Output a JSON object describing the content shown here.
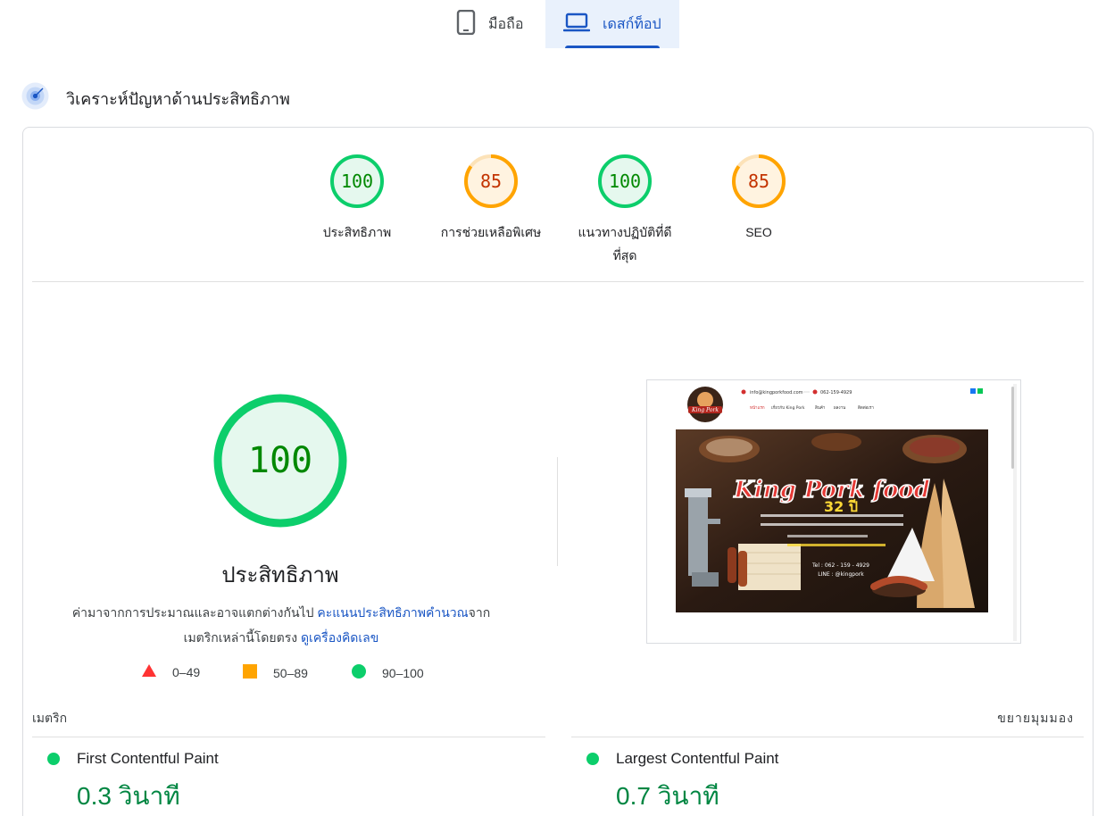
{
  "tabs": {
    "mobile": {
      "label": "มือถือ",
      "icon": "smartphone-icon"
    },
    "desktop": {
      "label": "เดสก์ท็อป",
      "icon": "laptop-icon",
      "selected": true
    }
  },
  "section": {
    "title": "วิเคราะห์ปัญหาด้านประสิทธิภาพ",
    "icon": "radar-icon"
  },
  "scores": [
    {
      "value": "100",
      "label": "ประสิทธิภาพ",
      "status": "pass"
    },
    {
      "value": "85",
      "label": "การช่วยเหลือพิเศษ",
      "status": "average"
    },
    {
      "value": "100",
      "label": "แนวทางปฏิบัติที่ดีที่สุด",
      "status": "pass"
    },
    {
      "value": "85",
      "label": "SEO",
      "status": "average"
    }
  ],
  "performance": {
    "score": "100",
    "title": "ประสิทธิภาพ",
    "desc_before": "ค่ามาจากการประมาณและอาจแตกต่างกันไป ",
    "desc_link1": "คะแนนประสิทธิภาพคำนวณ",
    "desc_middle": "จากเมตริกเหล่านี้โดยตรง ",
    "desc_link2": "ดูเครื่องคิดเลข"
  },
  "legend": [
    {
      "range": "0–49",
      "shape": "triangle",
      "color": "#ff3333"
    },
    {
      "range": "50–89",
      "shape": "square",
      "color": "#ffa400"
    },
    {
      "range": "90–100",
      "shape": "circle",
      "color": "#0cce6b"
    }
  ],
  "preview": {
    "email": "info@kingporkfood.com",
    "phone": "062-159-4929",
    "nav": [
      "หน้าแรก",
      "เกี่ยวกับ King Pork",
      "สินค้า",
      "ผลงาน",
      "ติดต่อเรา"
    ],
    "brand": "King Pork food",
    "tagline_years": "32 ปี",
    "tel": "Tel : 062 - 159 - 4929",
    "line": "LINE : @kingpork"
  },
  "metrics": {
    "header": "เมตริก",
    "expand_label": "ขยายมุมมอง",
    "items": [
      {
        "name": "First Contentful Paint",
        "value": "0.3 วินาที",
        "status": "pass"
      },
      {
        "name": "Largest Contentful Paint",
        "value": "0.7 วินาที",
        "status": "pass"
      }
    ]
  },
  "colors": {
    "pass": "#0cce6b",
    "pass_text": "#008800",
    "average": "#ffa400",
    "average_text": "#c33300",
    "fail": "#ff3333",
    "link": "#1a56c4"
  }
}
